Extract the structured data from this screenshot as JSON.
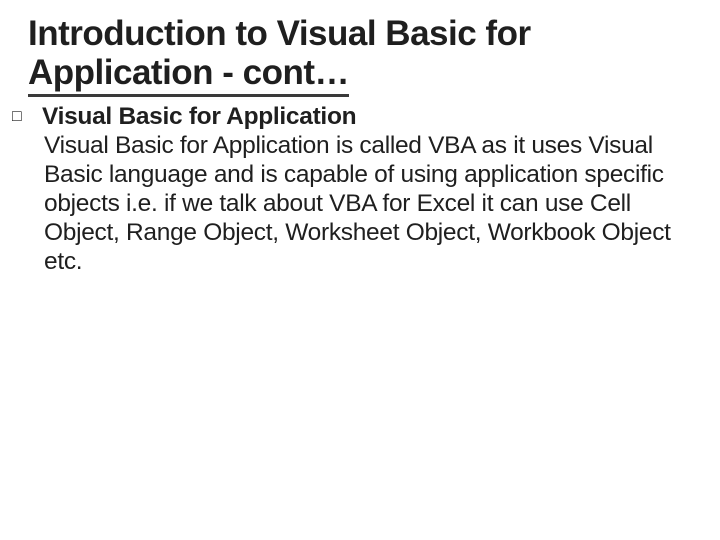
{
  "title_line1": "Introduction to Visual Basic for",
  "title_line2": "Application - cont…",
  "bullet_marker": "□",
  "heading_word1": "Visual",
  "heading_rest": " Basic for Application",
  "body_text": "Visual Basic for Application is called VBA as it uses Visual Basic language and is capable of using application specific objects i.e. if we talk about VBA for Excel it can use Cell Object, Range Object, Worksheet Object, Workbook Object etc."
}
